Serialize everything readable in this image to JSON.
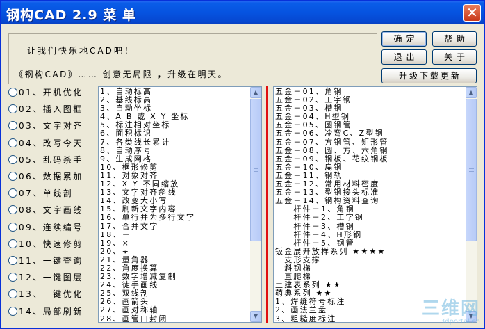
{
  "window": {
    "title": "钢构CAD 2.9 菜 单",
    "close_glyph": "✕"
  },
  "message": {
    "line1": "让我们快乐地CAD吧！",
    "line2": "《钢构CAD》…… 创意无局限 ，升级在明天。"
  },
  "buttons": {
    "ok": "确定",
    "help": "帮助",
    "exit": "退出",
    "about": "关于",
    "update": "升级下载更新"
  },
  "radio_options": [
    "01、开机优化",
    "02、插入图框",
    "03、文字对齐",
    "04、改写今天",
    "05、乱码杀手",
    "06、数据累加",
    "07、单线剖",
    "08、文字画线",
    "09、连续编号",
    "10、快速修剪",
    "11、一键查询",
    "12、一键图层",
    "13、一键优化",
    "14、局部刷新"
  ],
  "left_list": [
    "1、自动标高",
    "2、基线标高",
    "3、自动坐标",
    "4、A B 或 X Y 坐标",
    "5、标注相对坐标",
    "6、面积标识",
    "7、各类线长累计",
    "8、自动序号",
    "9、生成网格",
    "10、框形修剪",
    "11、对象对齐",
    "12、X Y 不同缩放",
    "13、文字对齐斜线",
    "14、改变大小写",
    "15、刷新文字内容",
    "16、单行并为多行文字",
    "17、合并文字",
    "18、－",
    "19、×",
    "20、÷",
    "21、量角器",
    "22、角度换算",
    "23、数字增减复制",
    "24、徒手画线",
    "25、双线剖",
    "26、画箭头",
    "27、画对称轴",
    "28、画管口封闭"
  ],
  "right_list": [
    "五金－01、角钢",
    "五金－02、工字钢",
    "五金－03、槽钢",
    "五金－04、H型钢",
    "五金－05、圆钢管",
    "五金－06、冷弯C、Z型钢",
    "五金－07、方钢管、矩形管",
    "五金－08、圆、方、六角钢",
    "五金－09、钢板、花纹钢板",
    "五金－10、扁钢",
    "五金－11、钢轨",
    "五金－12、常用材料密度",
    "五金－13、型钢接头标准",
    "五金－14、钢构资料查询",
    "　　杆件－1、角钢",
    "　　杆件－2、工字钢",
    "　　杆件－3、槽钢",
    "　　杆件－4、H形钢",
    "　　杆件－5、钢管",
    "钣金展开放样系列 ★★★★",
    "　支形支撑",
    "　斜钢梯",
    "　直爬梯",
    "土建表系列 ★★",
    "药典系列 ★★",
    "1、焊缝符号标注",
    "2、画法兰盘",
    "3、粗糙度标注"
  ],
  "watermark": {
    "big": "三维网",
    "small": "3dportal.cn"
  }
}
